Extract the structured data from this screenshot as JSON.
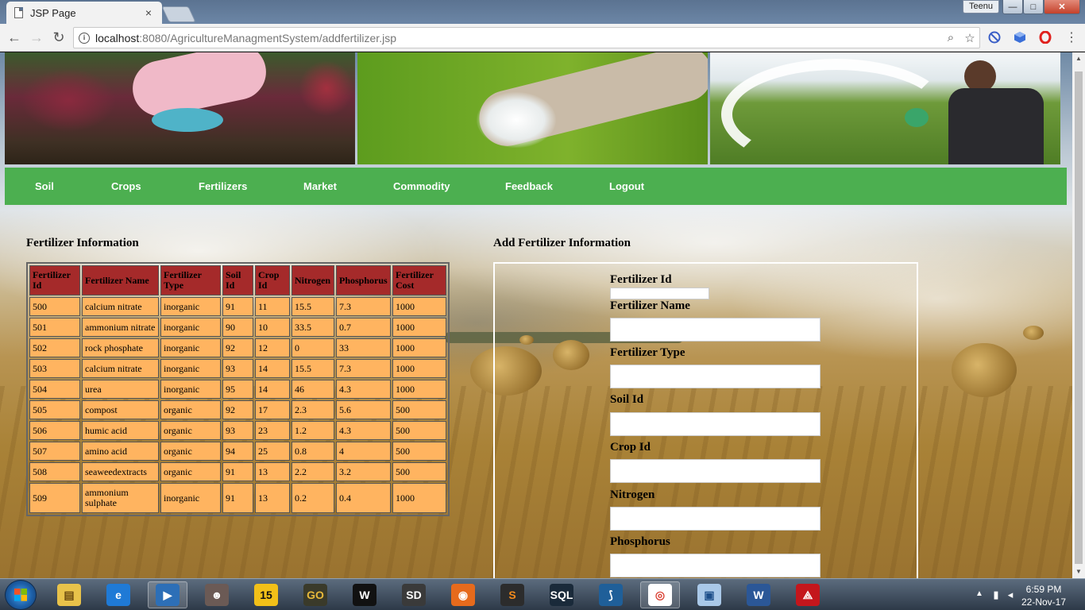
{
  "browser": {
    "tab_title": "JSP Page",
    "tab_close": "×",
    "user_label": "Teenu",
    "url_host": "localhost",
    "url_rest": ":8080/AgricultureManagmentSystem/addfertilizer.jsp",
    "back_icon": "←",
    "forward_icon": "→",
    "reload_icon": "↻",
    "info_icon": "i",
    "zoom_icon": "⌕",
    "star_icon": "☆",
    "menu_icon": "⋮",
    "min_icon": "—",
    "max_icon": "□",
    "close_icon": "✕"
  },
  "nav": {
    "items": [
      "Soil",
      "Crops",
      "Fertilizers",
      "Market",
      "Commodity",
      "Feedback",
      "Logout"
    ]
  },
  "left_section": {
    "title": "Fertilizer Information",
    "columns": [
      "Fertilizer Id",
      "Fertilizer Name",
      "Fertilizer Type",
      "Soil Id",
      "Crop Id",
      "Nitrogen",
      "Phosphorus",
      "Fertilizer Cost"
    ],
    "rows": [
      [
        "500",
        "calcium nitrate",
        "inorganic",
        "91",
        "11",
        "15.5",
        "7.3",
        "1000"
      ],
      [
        "501",
        "ammonium nitrate",
        "inorganic",
        "90",
        "10",
        "33.5",
        "0.7",
        "1000"
      ],
      [
        "502",
        "rock phosphate",
        "inorganic",
        "92",
        "12",
        "0",
        "33",
        "1000"
      ],
      [
        "503",
        "calcium nitrate",
        "inorganic",
        "93",
        "14",
        "15.5",
        "7.3",
        "1000"
      ],
      [
        "504",
        "urea",
        "inorganic",
        "95",
        "14",
        "46",
        "4.3",
        "1000"
      ],
      [
        "505",
        "compost",
        "organic",
        "92",
        "17",
        "2.3",
        "5.6",
        "500"
      ],
      [
        "506",
        "humic acid",
        "organic",
        "93",
        "23",
        "1.2",
        "4.3",
        "500"
      ],
      [
        "507",
        "amino acid",
        "organic",
        "94",
        "25",
        "0.8",
        "4",
        "500"
      ],
      [
        "508",
        "seaweedextracts",
        "organic",
        "91",
        "13",
        "2.2",
        "3.2",
        "500"
      ],
      [
        "509",
        "ammonium sulphate",
        "inorganic",
        "91",
        "13",
        "0.2",
        "0.4",
        "1000"
      ]
    ]
  },
  "right_section": {
    "title": "Add Fertilizer Information",
    "fields": [
      {
        "label": "Fertilizer Id",
        "value": ""
      },
      {
        "label": "Fertilizer Name",
        "value": ""
      },
      {
        "label": "Fertilizer Type",
        "value": ""
      },
      {
        "label": "Soil Id",
        "value": ""
      },
      {
        "label": "Crop Id",
        "value": ""
      },
      {
        "label": "Nitrogen",
        "value": ""
      },
      {
        "label": "Phosphorus",
        "value": ""
      }
    ]
  },
  "taskbar": {
    "apps": [
      "explorer",
      "internet-explorer",
      "media-player",
      "game",
      "15",
      "counter-strike",
      "wwe",
      "sleeping-dogs",
      "firefox",
      "sublime",
      "mysql",
      "mysql-workbench",
      "chrome",
      "virtualbox",
      "word",
      "acrobat"
    ],
    "app_glyphs": [
      "▤",
      "e",
      "▶",
      "☻",
      "15",
      "GO",
      "W",
      "SD",
      "◉",
      "S",
      "SQL",
      "⟆",
      "◎",
      "▣",
      "W",
      "⟁"
    ],
    "time": "6:59 PM",
    "date": "22-Nov-17",
    "tray_arrow": "▲"
  }
}
